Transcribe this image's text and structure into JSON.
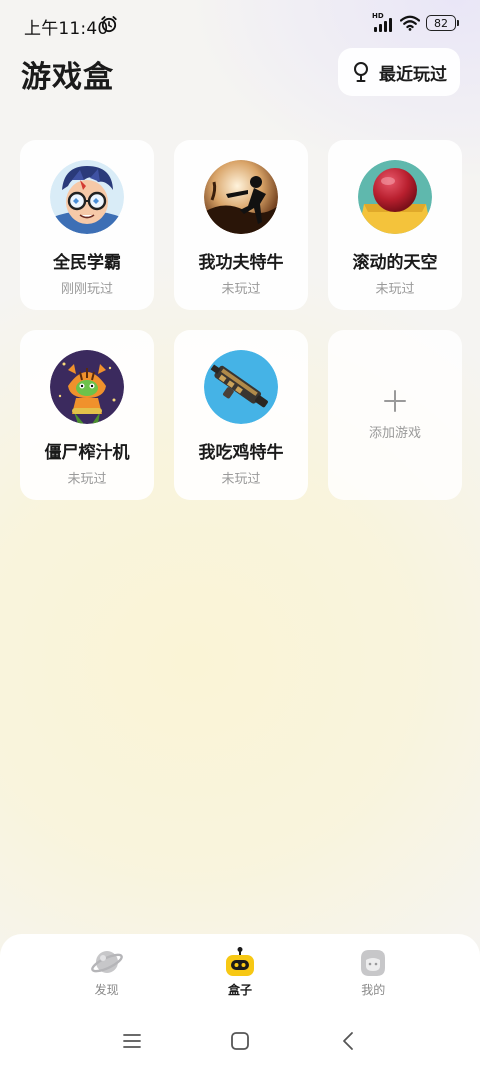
{
  "status_bar": {
    "time": "上午11:40",
    "battery": "82",
    "network_tag": "HD"
  },
  "header": {
    "title": "游戏盒",
    "recent_label": "最近玩过"
  },
  "games": [
    {
      "name": "全民学霸",
      "status": "刚刚玩过",
      "icon": "cartoon-boy-glasses-avatar"
    },
    {
      "name": "我功夫特牛",
      "status": "未玩过",
      "icon": "kungfu-silhouette-avatar"
    },
    {
      "name": "滚动的天空",
      "status": "未玩过",
      "icon": "red-ball-avatar"
    },
    {
      "name": "僵尸榨汁机",
      "status": "未玩过",
      "icon": "zombie-tiger-avatar"
    },
    {
      "name": "我吃鸡特牛",
      "status": "未玩过",
      "icon": "gun-avatar"
    }
  ],
  "add_game": {
    "label": "添加游戏",
    "icon": "plus-icon"
  },
  "bottom_nav": {
    "items": [
      {
        "label": "发现",
        "icon": "planet-icon",
        "active": false
      },
      {
        "label": "盒子",
        "icon": "robot-box-icon",
        "active": true
      },
      {
        "label": "我的",
        "icon": "profile-face-icon",
        "active": false
      }
    ]
  },
  "system_nav": {
    "icons": [
      "menu-icon",
      "home-icon",
      "back-icon"
    ]
  },
  "colors": {
    "accent_yellow": "#f7c814",
    "background_warm": "#faf4d6",
    "text_primary": "#1a1a1a",
    "text_secondary": "#9a9a9a"
  }
}
